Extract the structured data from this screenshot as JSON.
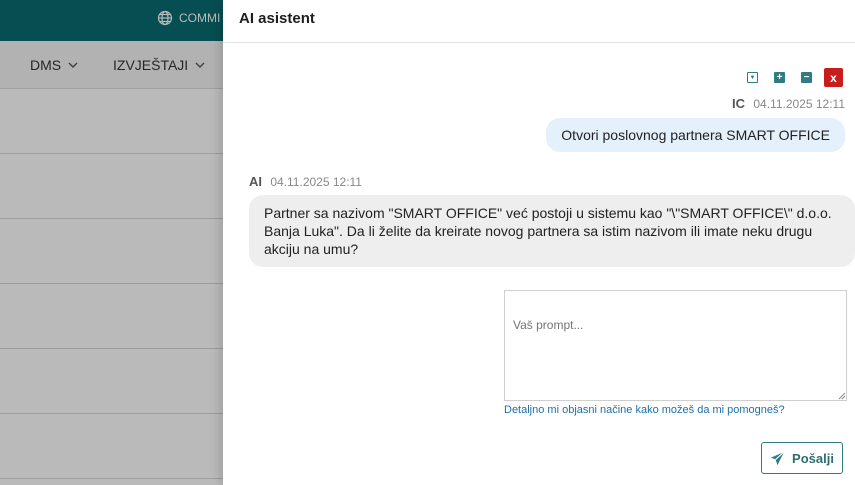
{
  "background_app": {
    "topbar_text": "COMMI",
    "menu": [
      "DMS",
      "IZVJEŠTAJI"
    ],
    "row_count": 6
  },
  "panel": {
    "title": "AI asistent",
    "controls": [
      "download-icon",
      "plus-icon",
      "minus-icon",
      "close-icon"
    ],
    "close_label": "x"
  },
  "messages": [
    {
      "sender": "IC",
      "time": "04.11.2025 12:11",
      "text": "Otvori poslovnog partnera SMART OFFICE"
    },
    {
      "sender": "AI",
      "time": "04.11.2025 12:11",
      "text": "Partner sa nazivom \"SMART OFFICE\" već postoji u sistemu kao \"\\\"SMART OFFICE\\\" d.o.o. Banja Luka\". Da li želite da kreirate novog partnera sa istim nazivom ili imate neku drugu akciju na umu?"
    }
  ],
  "prompt": {
    "placeholder": "Vaš prompt...",
    "value": "",
    "hint": "Detaljno mi objasni načine kako možeš da mi pomogneš?"
  },
  "send_button": {
    "label": "Pošalji"
  },
  "colors": {
    "brand": "#0a6b71",
    "accent": "#2f7c84",
    "close": "#c91d1d",
    "user_bubble": "#e4f0fc",
    "ai_bubble": "#eeeeee",
    "link": "#1f6fa8"
  }
}
